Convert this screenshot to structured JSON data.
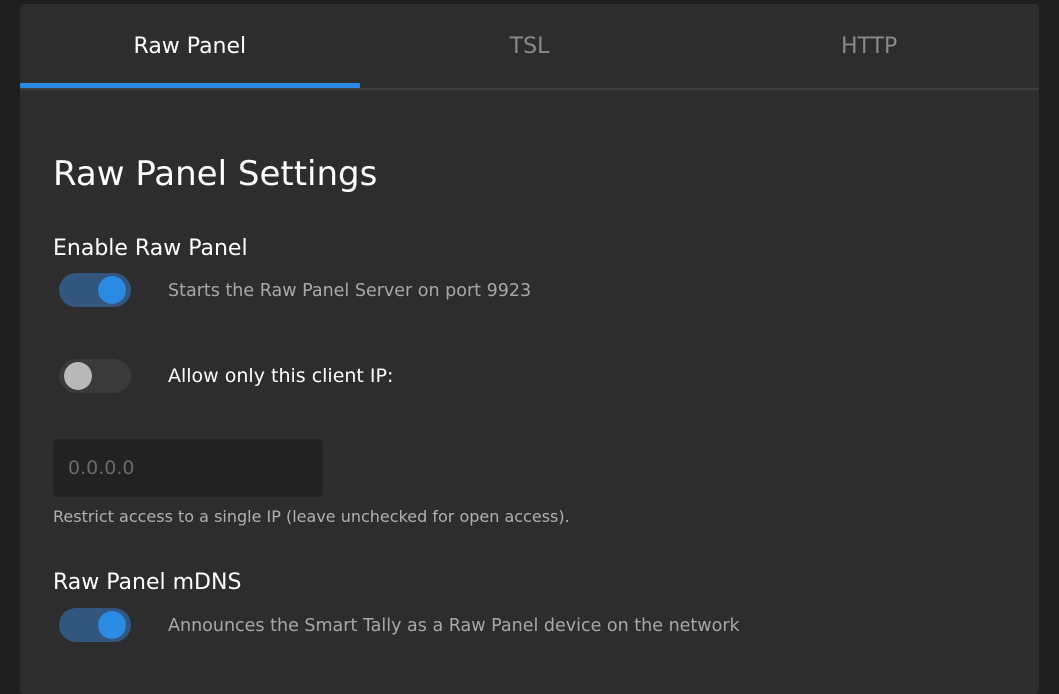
{
  "tabs": [
    {
      "label": "Raw Panel",
      "active": true
    },
    {
      "label": "TSL",
      "active": false
    },
    {
      "label": "HTTP",
      "active": false
    }
  ],
  "main": {
    "heading": "Raw Panel Settings",
    "enable_raw_panel": {
      "label": "Enable Raw Panel",
      "toggle_on": true,
      "description": "Starts the Raw Panel Server on port 9923"
    },
    "allow_client_ip": {
      "toggle_on": false,
      "label": "Allow only this client IP:",
      "input_value": "",
      "input_placeholder": "0.0.0.0",
      "hint": "Restrict access to a single IP (leave unchecked for open access)."
    },
    "mdns": {
      "label": "Raw Panel mDNS",
      "toggle_on": true,
      "description": "Announces the Smart Tally as a Raw Panel device on the network"
    }
  },
  "colors": {
    "accent": "#2b8ae3",
    "toggle_track_on": "#33567e",
    "toggle_track_off": "#3a3a3a",
    "panel_bg": "#2d2d2d",
    "page_bg": "#1e1e1e"
  }
}
